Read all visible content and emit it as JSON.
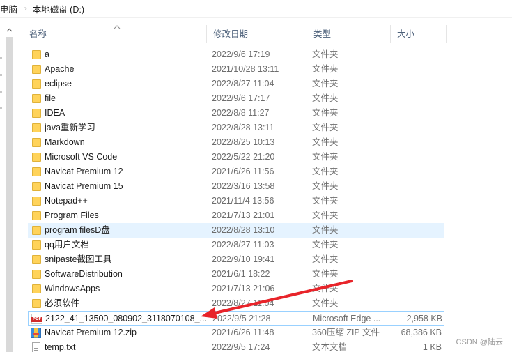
{
  "breadcrumb": {
    "items": [
      "电脑",
      "本地磁盘 (D:)"
    ],
    "separator": "›"
  },
  "columns": {
    "name": "名称",
    "date": "修改日期",
    "type": "类型",
    "size": "大小"
  },
  "files": [
    {
      "icon": "folder-icon",
      "name": "a",
      "date": "2022/9/6 17:19",
      "type": "文件夹",
      "size": ""
    },
    {
      "icon": "folder-icon",
      "name": "Apache",
      "date": "2021/10/28 13:11",
      "type": "文件夹",
      "size": ""
    },
    {
      "icon": "folder-icon",
      "name": "eclipse",
      "date": "2022/8/27 11:04",
      "type": "文件夹",
      "size": ""
    },
    {
      "icon": "folder-icon",
      "name": "file",
      "date": "2022/9/6 17:17",
      "type": "文件夹",
      "size": ""
    },
    {
      "icon": "folder-icon",
      "name": "IDEA",
      "date": "2022/8/8 11:27",
      "type": "文件夹",
      "size": ""
    },
    {
      "icon": "folder-icon",
      "name": "java重新学习",
      "date": "2022/8/28 13:11",
      "type": "文件夹",
      "size": ""
    },
    {
      "icon": "folder-icon",
      "name": "Markdown",
      "date": "2022/8/25 10:13",
      "type": "文件夹",
      "size": ""
    },
    {
      "icon": "folder-icon",
      "name": "Microsoft VS Code",
      "date": "2022/5/22 21:20",
      "type": "文件夹",
      "size": ""
    },
    {
      "icon": "folder-icon",
      "name": "Navicat Premium 12",
      "date": "2021/6/26 11:56",
      "type": "文件夹",
      "size": ""
    },
    {
      "icon": "folder-icon",
      "name": "Navicat Premium 15",
      "date": "2022/3/16 13:58",
      "type": "文件夹",
      "size": ""
    },
    {
      "icon": "folder-icon",
      "name": "Notepad++",
      "date": "2021/11/4 13:56",
      "type": "文件夹",
      "size": ""
    },
    {
      "icon": "folder-icon",
      "name": "Program Files",
      "date": "2021/7/13 21:01",
      "type": "文件夹",
      "size": ""
    },
    {
      "icon": "folder-icon",
      "name": "program filesD盘",
      "date": "2022/8/28 13:10",
      "type": "文件夹",
      "size": ""
    },
    {
      "icon": "folder-icon",
      "name": "qq用户文档",
      "date": "2022/8/27 11:03",
      "type": "文件夹",
      "size": ""
    },
    {
      "icon": "folder-icon",
      "name": "snipaste截图工具",
      "date": "2022/9/10 19:41",
      "type": "文件夹",
      "size": ""
    },
    {
      "icon": "folder-icon",
      "name": "SoftwareDistribution",
      "date": "2021/6/1 18:22",
      "type": "文件夹",
      "size": ""
    },
    {
      "icon": "folder-icon",
      "name": "WindowsApps",
      "date": "2021/7/13 21:06",
      "type": "文件夹",
      "size": ""
    },
    {
      "icon": "folder-icon",
      "name": "必须软件",
      "date": "2022/8/27 11:04",
      "type": "文件夹",
      "size": ""
    },
    {
      "icon": "pdf-icon",
      "name": "2122_41_13500_080902_3118070108_...",
      "date": "2022/9/5 21:28",
      "type": "Microsoft Edge ...",
      "size": "2,958 KB"
    },
    {
      "icon": "zip-icon",
      "name": "Navicat Premium 12.zip",
      "date": "2021/6/26 11:48",
      "type": "360压缩 ZIP 文件",
      "size": "68,386 KB"
    },
    {
      "icon": "txt-icon",
      "name": "temp.txt",
      "date": "2022/9/5 17:24",
      "type": "文本文档",
      "size": "1 KB"
    }
  ],
  "hover_row_index": 12,
  "focused_row_index": 18,
  "annotation": {
    "color": "#e8242a",
    "target": "pdf-file-row"
  },
  "watermark": "CSDN @陆云."
}
